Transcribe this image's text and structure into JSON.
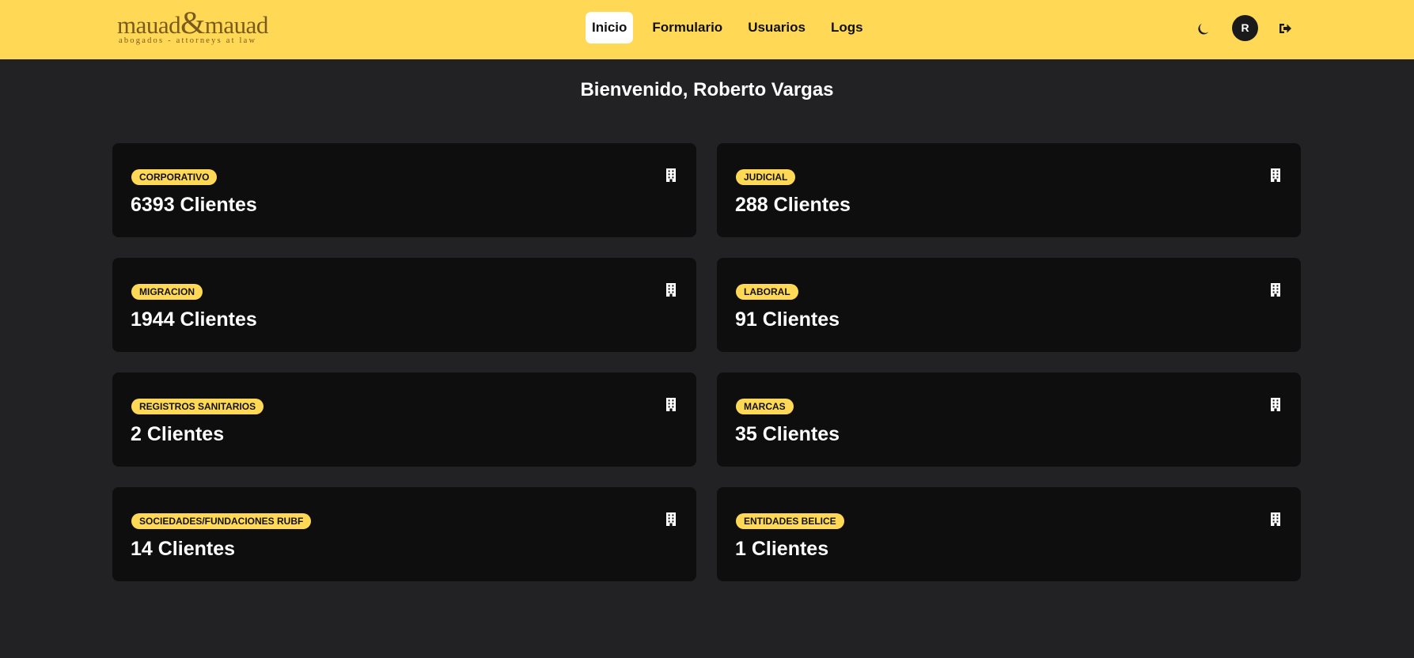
{
  "header": {
    "logo": {
      "word_left": "mauad",
      "amp": "&",
      "word_right": "mauad",
      "tagline": "abogados - attorneys at law"
    },
    "nav": [
      {
        "label": "Inicio",
        "active": true
      },
      {
        "label": "Formulario",
        "active": false
      },
      {
        "label": "Usuarios",
        "active": false
      },
      {
        "label": "Logs",
        "active": false
      }
    ],
    "avatar_initial": "R",
    "theme_toggle_icon": "moon-icon",
    "logout_icon": "logout-icon"
  },
  "welcome": "Bienvenido, Roberto Vargas",
  "cards": [
    {
      "category": "CORPORATIVO",
      "count_text": "6393 Clientes",
      "icon": "building-icon"
    },
    {
      "category": "JUDICIAL",
      "count_text": "288 Clientes",
      "icon": "building-icon"
    },
    {
      "category": "MIGRACION",
      "count_text": "1944 Clientes",
      "icon": "building-icon"
    },
    {
      "category": "LABORAL",
      "count_text": "91 Clientes",
      "icon": "building-icon"
    },
    {
      "category": "REGISTROS SANITARIOS",
      "count_text": "2 Clientes",
      "icon": "building-icon"
    },
    {
      "category": "MARCAS",
      "count_text": "35 Clientes",
      "icon": "building-icon"
    },
    {
      "category": "SOCIEDADES/FUNDACIONES RUBF",
      "count_text": "14 Clientes",
      "icon": "building-icon"
    },
    {
      "category": "ENTIDADES BELICE",
      "count_text": "1 Clientes",
      "icon": "building-icon"
    }
  ],
  "colors": {
    "accent": "#ffd955",
    "background": "#222224",
    "card": "#0e0e0e",
    "logo_text": "#7a5a1d"
  }
}
